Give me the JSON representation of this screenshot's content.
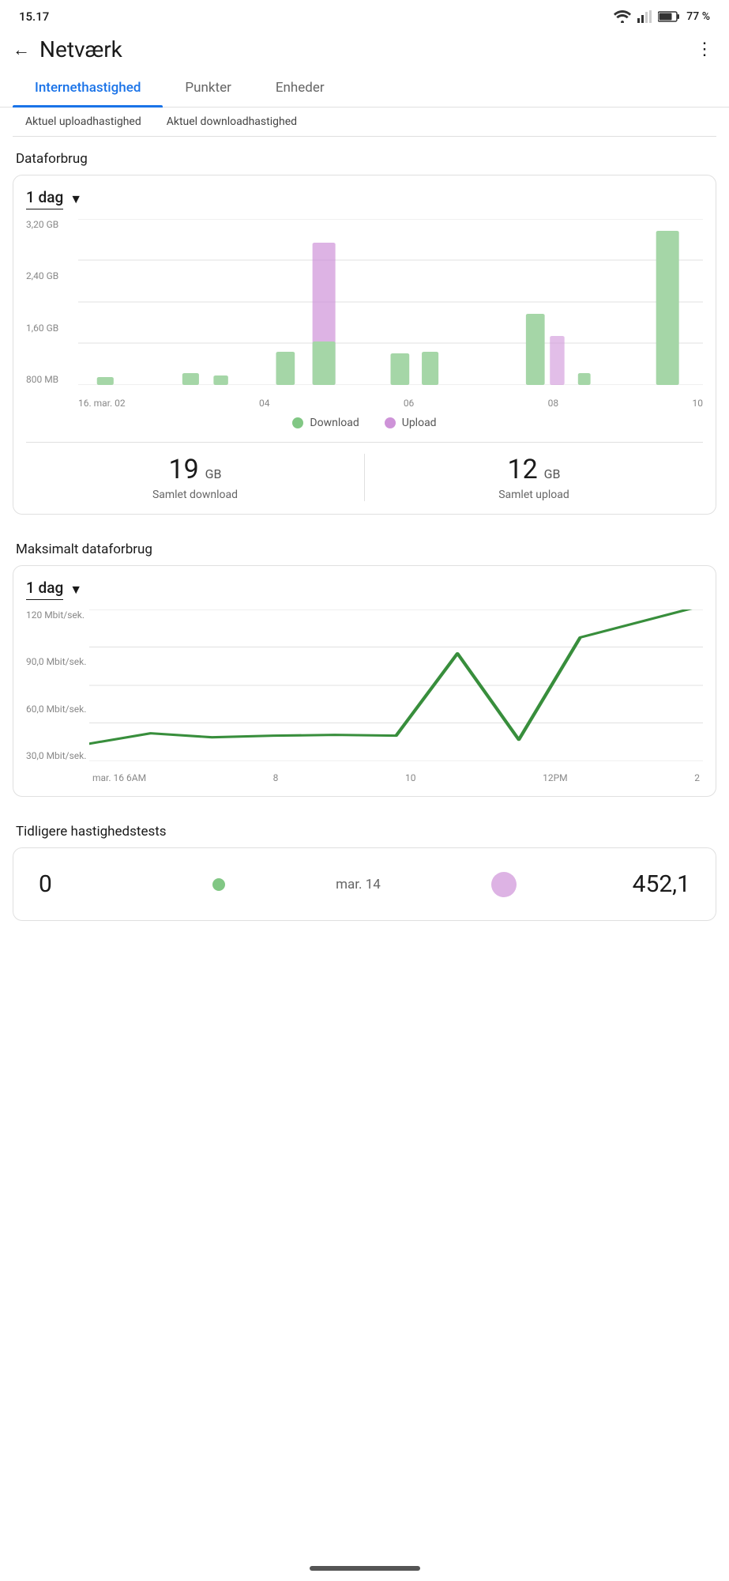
{
  "status": {
    "time": "15.17",
    "battery": "77 %"
  },
  "header": {
    "title": "Netværk",
    "back_label": "←",
    "more_label": "⋮"
  },
  "tabs": [
    {
      "id": "internet",
      "label": "Internethastighed",
      "active": true
    },
    {
      "id": "punkter",
      "label": "Punkter",
      "active": false
    },
    {
      "id": "enheder",
      "label": "Enheder",
      "active": false
    }
  ],
  "sub_tabs": [
    {
      "label": "Aktuel uploadhastighed"
    },
    {
      "label": "Aktuel downloadhastighed"
    }
  ],
  "dataforbrug": {
    "section_label": "Dataforbrug",
    "dropdown_label": "1 dag",
    "y_labels": [
      "800 MB",
      "1,60 GB",
      "2,40 GB",
      "3,20 GB"
    ],
    "x_labels": [
      "16. mar. 02",
      "04",
      "06",
      "08",
      "10"
    ],
    "legend": {
      "download_label": "Download",
      "upload_label": "Upload",
      "download_color": "#81c784",
      "upload_color": "#ce93d8"
    },
    "stats": {
      "download_num": "19",
      "download_unit": "GB",
      "download_desc": "Samlet download",
      "upload_num": "12",
      "upload_unit": "GB",
      "upload_desc": "Samlet upload"
    }
  },
  "maksimalt": {
    "section_label": "Maksimalt dataforbrug",
    "dropdown_label": "1 dag",
    "y_labels": [
      "30,0 Mbit/sek.",
      "60,0 Mbit/sek.",
      "90,0 Mbit/sek.",
      "120 Mbit/sek."
    ],
    "x_labels": [
      "mar. 16 6AM",
      "8",
      "10",
      "12PM",
      "2"
    ]
  },
  "previous_tests": {
    "section_label": "Tidligere hastighedstests",
    "item": {
      "left_value": "0",
      "dot_green": true,
      "date": "mar. 14",
      "dot_purple": true,
      "right_value": "452,1"
    }
  },
  "bottom": {
    "pill": "—"
  }
}
